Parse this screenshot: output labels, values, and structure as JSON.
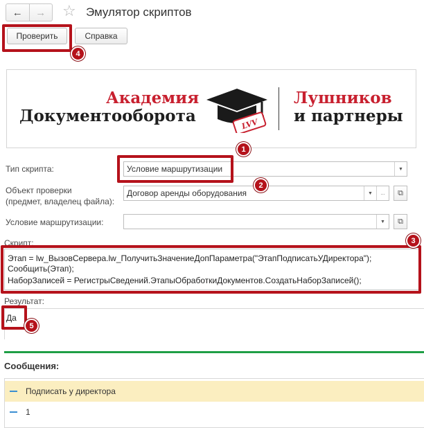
{
  "window": {
    "title": "Эмулятор скриптов",
    "back_icon": "←",
    "forward_icon": "→",
    "favorite_icon": "☆"
  },
  "toolbar": {
    "check_label": "Проверить",
    "help_label": "Справка"
  },
  "logo": {
    "left_line1": "Академия",
    "left_line2": "Документооборота",
    "right_line1": "Лушников",
    "right_line2": "и партнеры",
    "badge_text": "LVV"
  },
  "form": {
    "script_type_label": "Тип скрипта:",
    "script_type_value": "Условие маршрутизации",
    "check_object_label_line1": "Объект проверки",
    "check_object_label_line2": "(предмет, владелец файла):",
    "check_object_value": "Договор аренды оборудования",
    "routing_condition_label": "Условие маршрутизации:",
    "routing_condition_value": "",
    "dropdown_icon": "▼",
    "choose_icon": "...",
    "open_icon": "⧉"
  },
  "script": {
    "label": "Скрипт:",
    "lines": [
      "Этап = lw_ВызовСервера.lw_ПолучитьЗначениеДопПараметра(\"ЭтапПодписатьУДиректора\");",
      " Сообщить(Этап);",
      "  НаборЗаписей = РегистрыСведений.ЭтапыОбработкиДокументов.СоздатьНаборЗаписей();"
    ]
  },
  "result": {
    "label": "Результат:",
    "value": "Да"
  },
  "messages": {
    "title": "Сообщения:",
    "items": [
      "Подписать у директора",
      "1"
    ]
  },
  "callouts": [
    "1",
    "2",
    "3",
    "4",
    "5"
  ],
  "colors": {
    "accent_red": "#b5121b",
    "brand_red": "#c8202f",
    "green_bar": "#1e9e45",
    "selected_row": "#fbeec0"
  }
}
